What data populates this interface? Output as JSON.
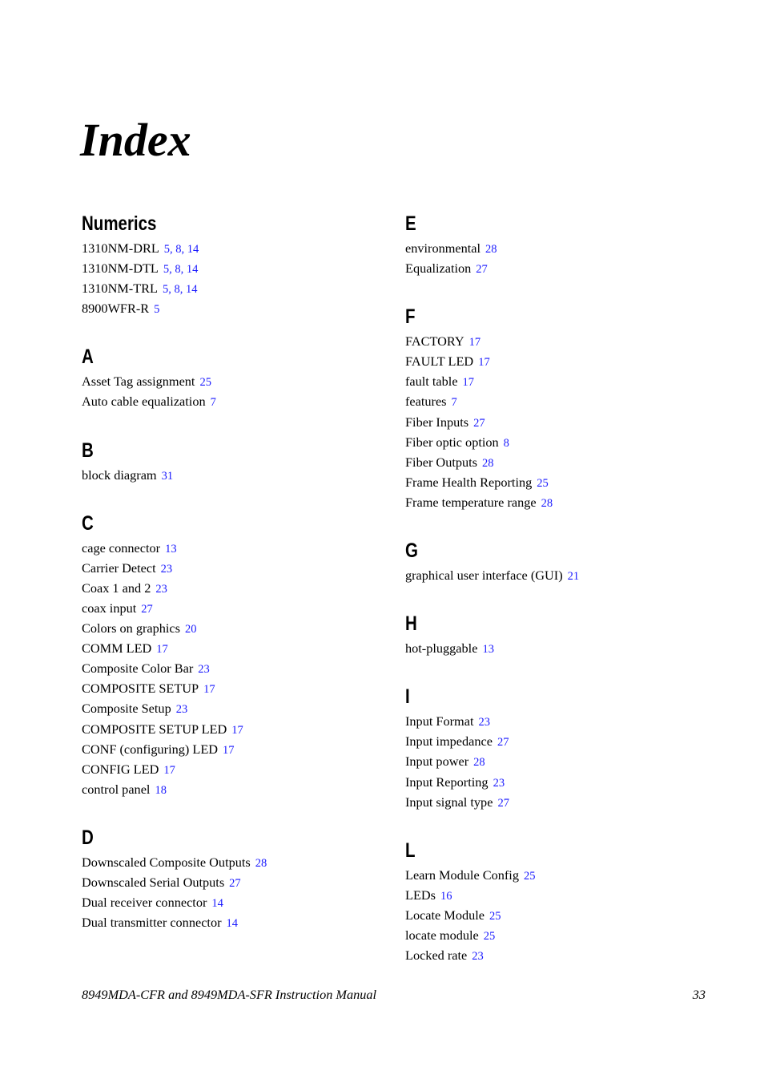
{
  "page_title": "Index",
  "link_color": "#1a1aff",
  "columns": [
    {
      "sections": [
        {
          "heading": "Numerics",
          "entries": [
            {
              "term": "1310NM-DRL",
              "pages": [
                "5",
                "8",
                "14"
              ]
            },
            {
              "term": "1310NM-DTL",
              "pages": [
                "5",
                "8",
                "14"
              ]
            },
            {
              "term": "1310NM-TRL",
              "pages": [
                "5",
                "8",
                "14"
              ]
            },
            {
              "term": "8900WFR-R",
              "pages": [
                "5"
              ]
            }
          ]
        },
        {
          "heading": "A",
          "entries": [
            {
              "term": "Asset Tag assignment",
              "pages": [
                "25"
              ]
            },
            {
              "term": "Auto cable equalization",
              "pages": [
                "7"
              ]
            }
          ]
        },
        {
          "heading": "B",
          "entries": [
            {
              "term": "block diagram",
              "pages": [
                "31"
              ]
            }
          ]
        },
        {
          "heading": "C",
          "entries": [
            {
              "term": "cage connector",
              "pages": [
                "13"
              ]
            },
            {
              "term": "Carrier Detect",
              "pages": [
                "23"
              ]
            },
            {
              "term": "Coax 1 and 2",
              "pages": [
                "23"
              ]
            },
            {
              "term": "coax input",
              "pages": [
                "27"
              ]
            },
            {
              "term": "Colors on graphics",
              "pages": [
                "20"
              ]
            },
            {
              "term": "COMM LED",
              "pages": [
                "17"
              ]
            },
            {
              "term": "Composite Color Bar",
              "pages": [
                "23"
              ]
            },
            {
              "term": "COMPOSITE SETUP",
              "pages": [
                "17"
              ]
            },
            {
              "term": "Composite Setup",
              "pages": [
                "23"
              ]
            },
            {
              "term": "COMPOSITE SETUP LED",
              "pages": [
                "17"
              ]
            },
            {
              "term": "CONF (configuring) LED",
              "pages": [
                "17"
              ]
            },
            {
              "term": "CONFIG LED",
              "pages": [
                "17"
              ]
            },
            {
              "term": "control panel",
              "pages": [
                "18"
              ]
            }
          ]
        },
        {
          "heading": "D",
          "entries": [
            {
              "term": "Downscaled Composite Outputs",
              "pages": [
                "28"
              ]
            },
            {
              "term": "Downscaled Serial Outputs",
              "pages": [
                "27"
              ]
            },
            {
              "term": "Dual receiver connector",
              "pages": [
                "14"
              ]
            },
            {
              "term": "Dual transmitter connector",
              "pages": [
                "14"
              ]
            }
          ]
        }
      ]
    },
    {
      "sections": [
        {
          "heading": "E",
          "entries": [
            {
              "term": "environmental",
              "pages": [
                "28"
              ]
            },
            {
              "term": "Equalization",
              "pages": [
                "27"
              ]
            }
          ]
        },
        {
          "heading": "F",
          "entries": [
            {
              "term": "FACTORY",
              "pages": [
                "17"
              ]
            },
            {
              "term": "FAULT LED",
              "pages": [
                "17"
              ]
            },
            {
              "term": "fault table",
              "pages": [
                "17"
              ]
            },
            {
              "term": "features",
              "pages": [
                "7"
              ]
            },
            {
              "term": "Fiber Inputs",
              "pages": [
                "27"
              ]
            },
            {
              "term": "Fiber optic option",
              "pages": [
                "8"
              ]
            },
            {
              "term": "Fiber Outputs",
              "pages": [
                "28"
              ]
            },
            {
              "term": "Frame Health Reporting",
              "pages": [
                "25"
              ]
            },
            {
              "term": "Frame temperature range",
              "pages": [
                "28"
              ]
            }
          ]
        },
        {
          "heading": "G",
          "entries": [
            {
              "term": "graphical user interface (GUI)",
              "pages": [
                "21"
              ]
            }
          ]
        },
        {
          "heading": "H",
          "entries": [
            {
              "term": "hot-pluggable",
              "pages": [
                "13"
              ]
            }
          ]
        },
        {
          "heading": "I",
          "entries": [
            {
              "term": "Input Format",
              "pages": [
                "23"
              ]
            },
            {
              "term": "Input impedance",
              "pages": [
                "27"
              ]
            },
            {
              "term": "Input power",
              "pages": [
                "28"
              ]
            },
            {
              "term": "Input Reporting",
              "pages": [
                "23"
              ]
            },
            {
              "term": "Input signal type",
              "pages": [
                "27"
              ]
            }
          ]
        },
        {
          "heading": "L",
          "entries": [
            {
              "term": "Learn Module Config",
              "pages": [
                "25"
              ]
            },
            {
              "term": "LEDs",
              "pages": [
                "16"
              ]
            },
            {
              "term": "Locate Module",
              "pages": [
                "25"
              ]
            },
            {
              "term": "locate module",
              "pages": [
                "25"
              ]
            },
            {
              "term": "Locked rate",
              "pages": [
                "23"
              ]
            }
          ]
        }
      ]
    }
  ],
  "footer": {
    "manual_title": "8949MDA-CFR and 8949MDA-SFR Instruction Manual",
    "page_number": "33"
  }
}
